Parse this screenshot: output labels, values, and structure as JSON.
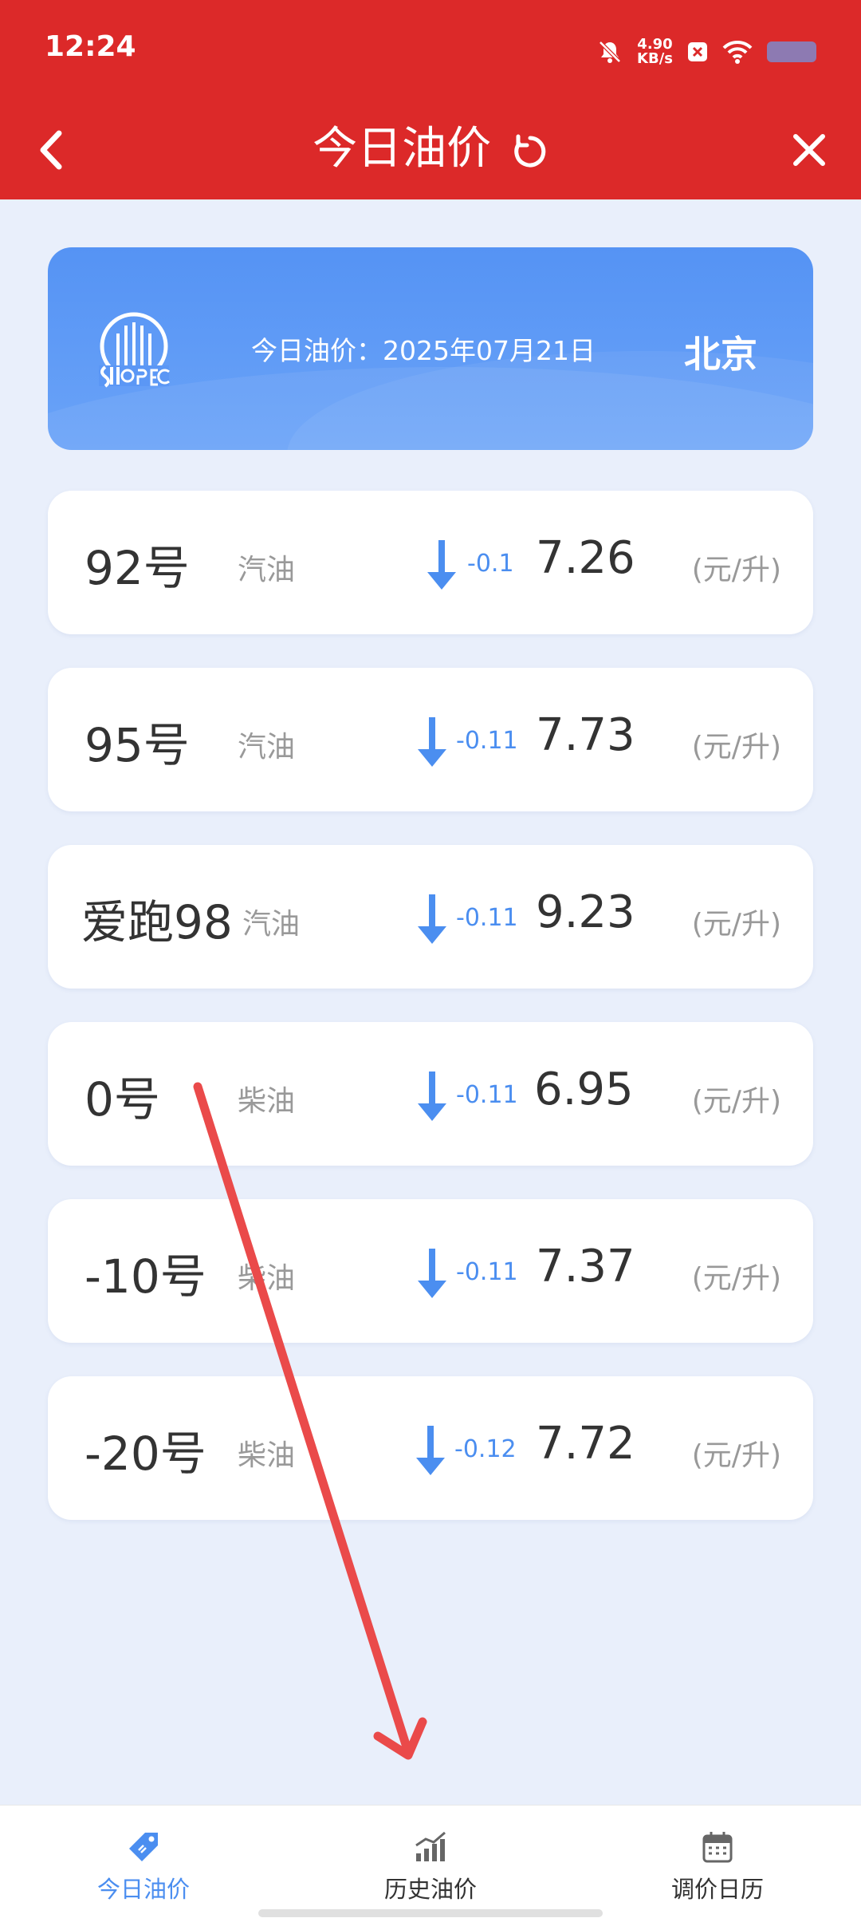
{
  "status_bar": {
    "time": "12:24",
    "speed_value": "4.90",
    "speed_unit": "KB/s",
    "icons": [
      "bell-mute-icon",
      "app-badge-icon",
      "wifi-icon",
      "battery-icon"
    ]
  },
  "app_bar": {
    "title": "今日油价",
    "icons": [
      "back-icon",
      "refresh-icon",
      "close-icon"
    ]
  },
  "header": {
    "logo": "sinopec-logo",
    "date_label": "今日油价：2025年07月21日",
    "city": "北京"
  },
  "fuels": [
    {
      "grade": "92号",
      "type": "汽油",
      "change": "-0.1",
      "price": "7.26",
      "unit": "(元/升)"
    },
    {
      "grade": "95号",
      "type": "汽油",
      "change": "-0.11",
      "price": "7.73",
      "unit": "(元/升)"
    },
    {
      "grade": "爱跑98",
      "type": "汽油",
      "change": "-0.11",
      "price": "9.23",
      "unit": "(元/升)"
    },
    {
      "grade": "0号",
      "type": "柴油",
      "change": "-0.11",
      "price": "6.95",
      "unit": "(元/升)"
    },
    {
      "grade": "-10号",
      "type": "柴油",
      "change": "-0.11",
      "price": "7.37",
      "unit": "(元/升)"
    },
    {
      "grade": "-20号",
      "type": "柴油",
      "change": "-0.12",
      "price": "7.72",
      "unit": "(元/升)"
    }
  ],
  "bottom_nav": [
    {
      "label": "今日油价",
      "icon": "price-tag-icon",
      "active": true
    },
    {
      "label": "历史油价",
      "icon": "bar-chart-icon",
      "active": false
    },
    {
      "label": "调价日历",
      "icon": "calendar-icon",
      "active": false
    }
  ],
  "colors": {
    "brand_red": "#dc2929",
    "accent_blue": "#4b8ef0",
    "background": "#e9effb",
    "annotation_arrow": "#ea4a4a"
  }
}
